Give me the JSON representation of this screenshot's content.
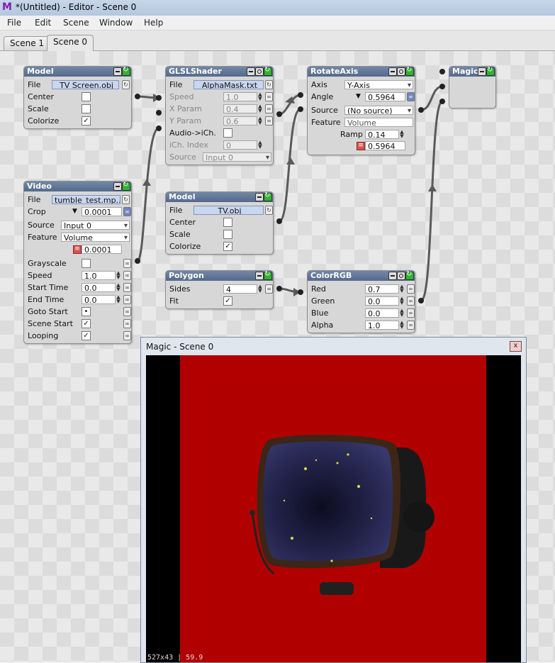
{
  "app": {
    "window_title": "*(Untitled) - Editor - Scene 0",
    "logo_glyph": "M"
  },
  "menu": [
    "File",
    "Edit",
    "Scene",
    "Window",
    "Help"
  ],
  "tabs": [
    "Scene 1",
    "Scene 0"
  ],
  "nodes": {
    "model1": {
      "title": "Model",
      "file_label": "File",
      "file_value": "TV Screen.obj",
      "center_label": "Center",
      "scale_label": "Scale",
      "colorize_label": "Colorize"
    },
    "video": {
      "title": "Video",
      "file_label": "File",
      "file_value": "tumble_test.mp...",
      "crop_label": "Crop",
      "crop_value": "0.0001",
      "source_label": "Source",
      "source_value": "Input 0",
      "feature_label": "Feature",
      "feature_value": "Volume",
      "eq_value": "0.0001",
      "grayscale_label": "Grayscale",
      "speed_label": "Speed",
      "speed_value": "1.0",
      "start_label": "Start Time",
      "start_value": "0.0",
      "end_label": "End Time",
      "end_value": "0.0",
      "goto_label": "Goto Start",
      "scenestart_label": "Scene Start",
      "looping_label": "Looping"
    },
    "glsl": {
      "title": "GLSLShader",
      "file_label": "File",
      "file_value": "AlphaMask.txt",
      "speed_label": "Speed",
      "speed_value": "1.0",
      "xparam_label": "X Param",
      "xparam_value": "0.4",
      "yparam_label": "Y Param",
      "yparam_value": "0.6",
      "audio_label": "Audio->iCh.",
      "ich_label": "iCh. Index",
      "ich_value": "0",
      "source_label": "Source",
      "source_value": "Input 0"
    },
    "model2": {
      "title": "Model",
      "file_label": "File",
      "file_value": "TV.obj",
      "center_label": "Center",
      "scale_label": "Scale",
      "colorize_label": "Colorize"
    },
    "polygon": {
      "title": "Polygon",
      "sides_label": "Sides",
      "sides_value": "4",
      "fit_label": "Fit"
    },
    "rotate": {
      "title": "RotateAxis",
      "axis_label": "Axis",
      "axis_value": "Y-Axis",
      "angle_label": "Angle",
      "angle_value": "0.5964",
      "source_label": "Source",
      "source_value": "(No source)",
      "feature_label": "Feature",
      "feature_value": "Volume",
      "ramp_label": "Ramp",
      "ramp_value": "0.14",
      "eq_value": "0.5964"
    },
    "color": {
      "title": "ColorRGB",
      "red_label": "Red",
      "red_value": "0.7",
      "green_label": "Green",
      "green_value": "0.0",
      "blue_label": "Blue",
      "blue_value": "0.0",
      "alpha_label": "Alpha",
      "alpha_value": "1.0"
    },
    "magic": {
      "title": "Magic"
    }
  },
  "magic_window": {
    "title": "Magic - Scene 0",
    "close_glyph": "x",
    "stats": "527x43 | 59.9"
  },
  "colors": {
    "render_background": "#b10000",
    "header": "#5f7395"
  }
}
